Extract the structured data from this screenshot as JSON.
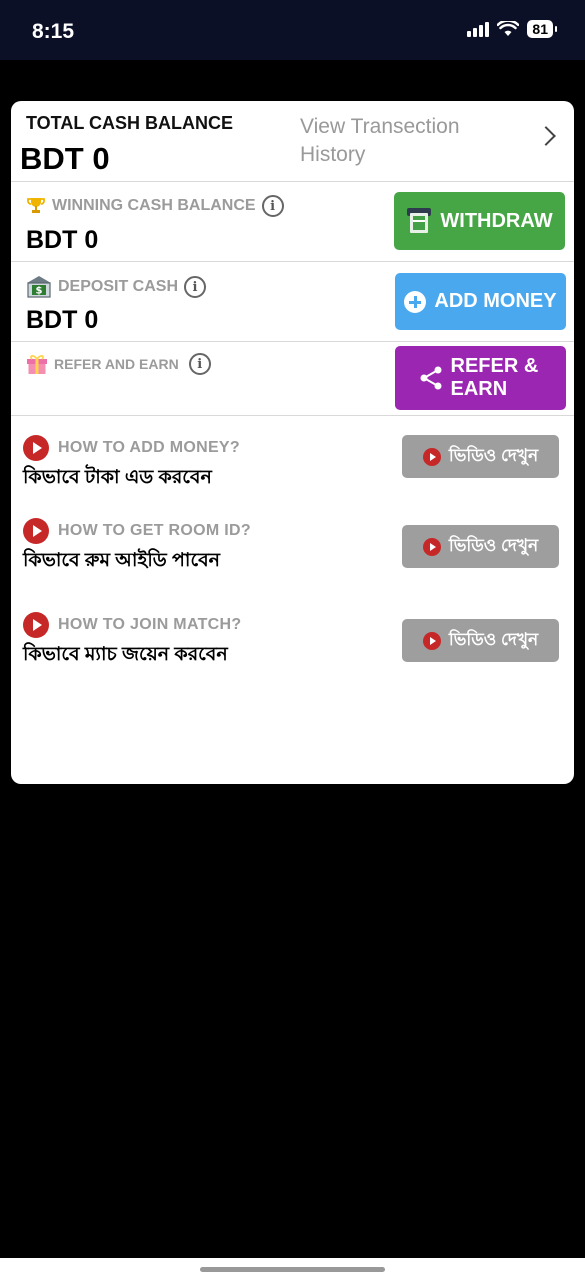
{
  "status": {
    "time": "8:15",
    "battery": "81"
  },
  "total": {
    "label": "TOTAL CASH BALANCE",
    "value": "BDT 0",
    "history_link": "View Transection History"
  },
  "winning": {
    "label": "WINNING CASH BALANCE",
    "value": "BDT 0",
    "button": "WITHDRAW"
  },
  "deposit": {
    "label": "DEPOSIT CASH",
    "value": "BDT 0",
    "button": "ADD MONEY"
  },
  "refer": {
    "label": "REFER AND EARN",
    "button": "REFER & EARN"
  },
  "tutorials": [
    {
      "title": "HOW TO ADD MONEY?",
      "subtitle": "কিভাবে টাকা এড করবেন",
      "button": "ভিডিও দেখুন"
    },
    {
      "title": "HOW TO GET ROOM ID?",
      "subtitle": "কিভাবে রুম আইডি পাবেন",
      "button": "ভিডিও দেখুন"
    },
    {
      "title": "HOW TO JOIN MATCH?",
      "subtitle": "কিভাবে ম্যাচ জয়েন করবেন",
      "button": "ভিডিও দেখুন"
    }
  ],
  "colors": {
    "withdraw": "#46a545",
    "add_money": "#4aa8ee",
    "refer": "#9b26b2",
    "video_button": "#9e9e9e",
    "play": "#c62828"
  },
  "icons": {
    "winning": "trophy-icon",
    "deposit": "bank-icon",
    "refer": "gift-icon",
    "withdraw": "atm-icon",
    "add_money": "plus-circle-icon",
    "refer_button": "share-icon",
    "tutorial": "play-icon"
  }
}
